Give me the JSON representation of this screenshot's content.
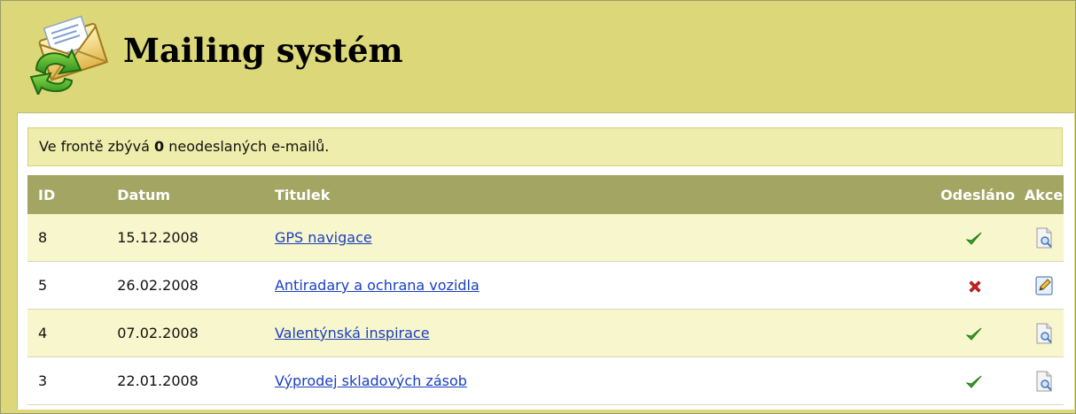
{
  "header": {
    "title": "Mailing systém",
    "logo_icon": "mail-envelope-refresh-icon"
  },
  "notice": {
    "prefix": "Ve frontě zbývá ",
    "count": "0",
    "suffix": " neodeslaných e-mailů."
  },
  "table": {
    "columns": [
      "ID",
      "Datum",
      "Titulek",
      "Odesláno",
      "Akce"
    ],
    "rows": [
      {
        "id": "8",
        "date": "15.12.2008",
        "title": "GPS navigace",
        "sent": true,
        "action_icon": "preview-icon"
      },
      {
        "id": "5",
        "date": "26.02.2008",
        "title": "Antiradary a ochrana vozidla",
        "sent": false,
        "action_icon": "edit-icon"
      },
      {
        "id": "4",
        "date": "07.02.2008",
        "title": "Valentýnská inspirace",
        "sent": true,
        "action_icon": "preview-icon"
      },
      {
        "id": "3",
        "date": "22.01.2008",
        "title": "Výprodej skladových zásob",
        "sent": true,
        "action_icon": "preview-icon"
      }
    ]
  },
  "colors": {
    "frame_background": "#dcd87a",
    "table_header": "#a3a562",
    "row_highlight": "#f8f6cc",
    "link": "#1a3fc0",
    "sent_check": "#3aa028",
    "not_sent_cross": "#d42020"
  }
}
